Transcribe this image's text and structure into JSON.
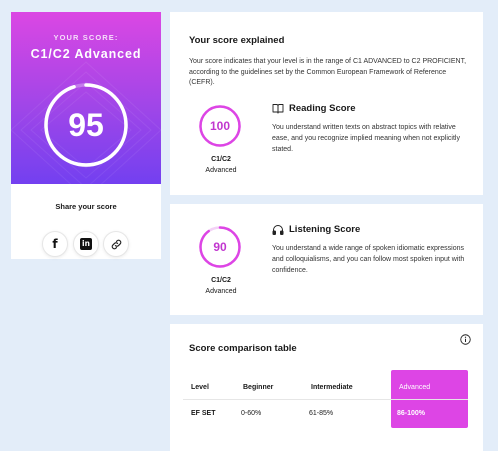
{
  "score_card": {
    "eyebrow": "YOUR SCORE:",
    "level": "C1/C2 Advanced",
    "score": "95",
    "score_fraction": 0.95,
    "share_title": "Share your score",
    "share_buttons": [
      {
        "icon": "facebook-icon",
        "glyph": "f"
      },
      {
        "icon": "linkedin-icon",
        "glyph": "in"
      },
      {
        "icon": "link-icon"
      }
    ]
  },
  "explained": {
    "title": "Your score explained",
    "text": "Your score indicates that your level is in the range of C1 ADVANCED to C2 PROFICIENT, according to the guidelines set by the Common European Framework of Reference (CEFR)."
  },
  "reading": {
    "score": "100",
    "score_fraction": 1.0,
    "level_code": "C1/C2",
    "level_name": "Advanced",
    "title": "Reading Score",
    "icon": "book-icon",
    "text": "You understand written texts on abstract topics with relative ease, and you recognize implied meaning when not explicitly stated."
  },
  "listening": {
    "score": "90",
    "score_fraction": 0.9,
    "level_code": "C1/C2",
    "level_name": "Advanced",
    "title": "Listening Score",
    "icon": "headphones-icon",
    "text": "You understand a wide range of spoken idiomatic expressions and colloquialisms, and you can follow most spoken input with confidence."
  },
  "comparison": {
    "title": "Score comparison table",
    "headers": [
      "Level",
      "Beginner",
      "Intermediate",
      "Advanced"
    ],
    "row": [
      "EF SET",
      "0-60%",
      "61-85%",
      "86-100%"
    ]
  },
  "colors": {
    "accent": "#dd45e5",
    "accent_dark": "#c136cf",
    "gradient_top": "#db47e3",
    "gradient_bottom": "#7340f0",
    "page_bg": "#e3edf9"
  }
}
